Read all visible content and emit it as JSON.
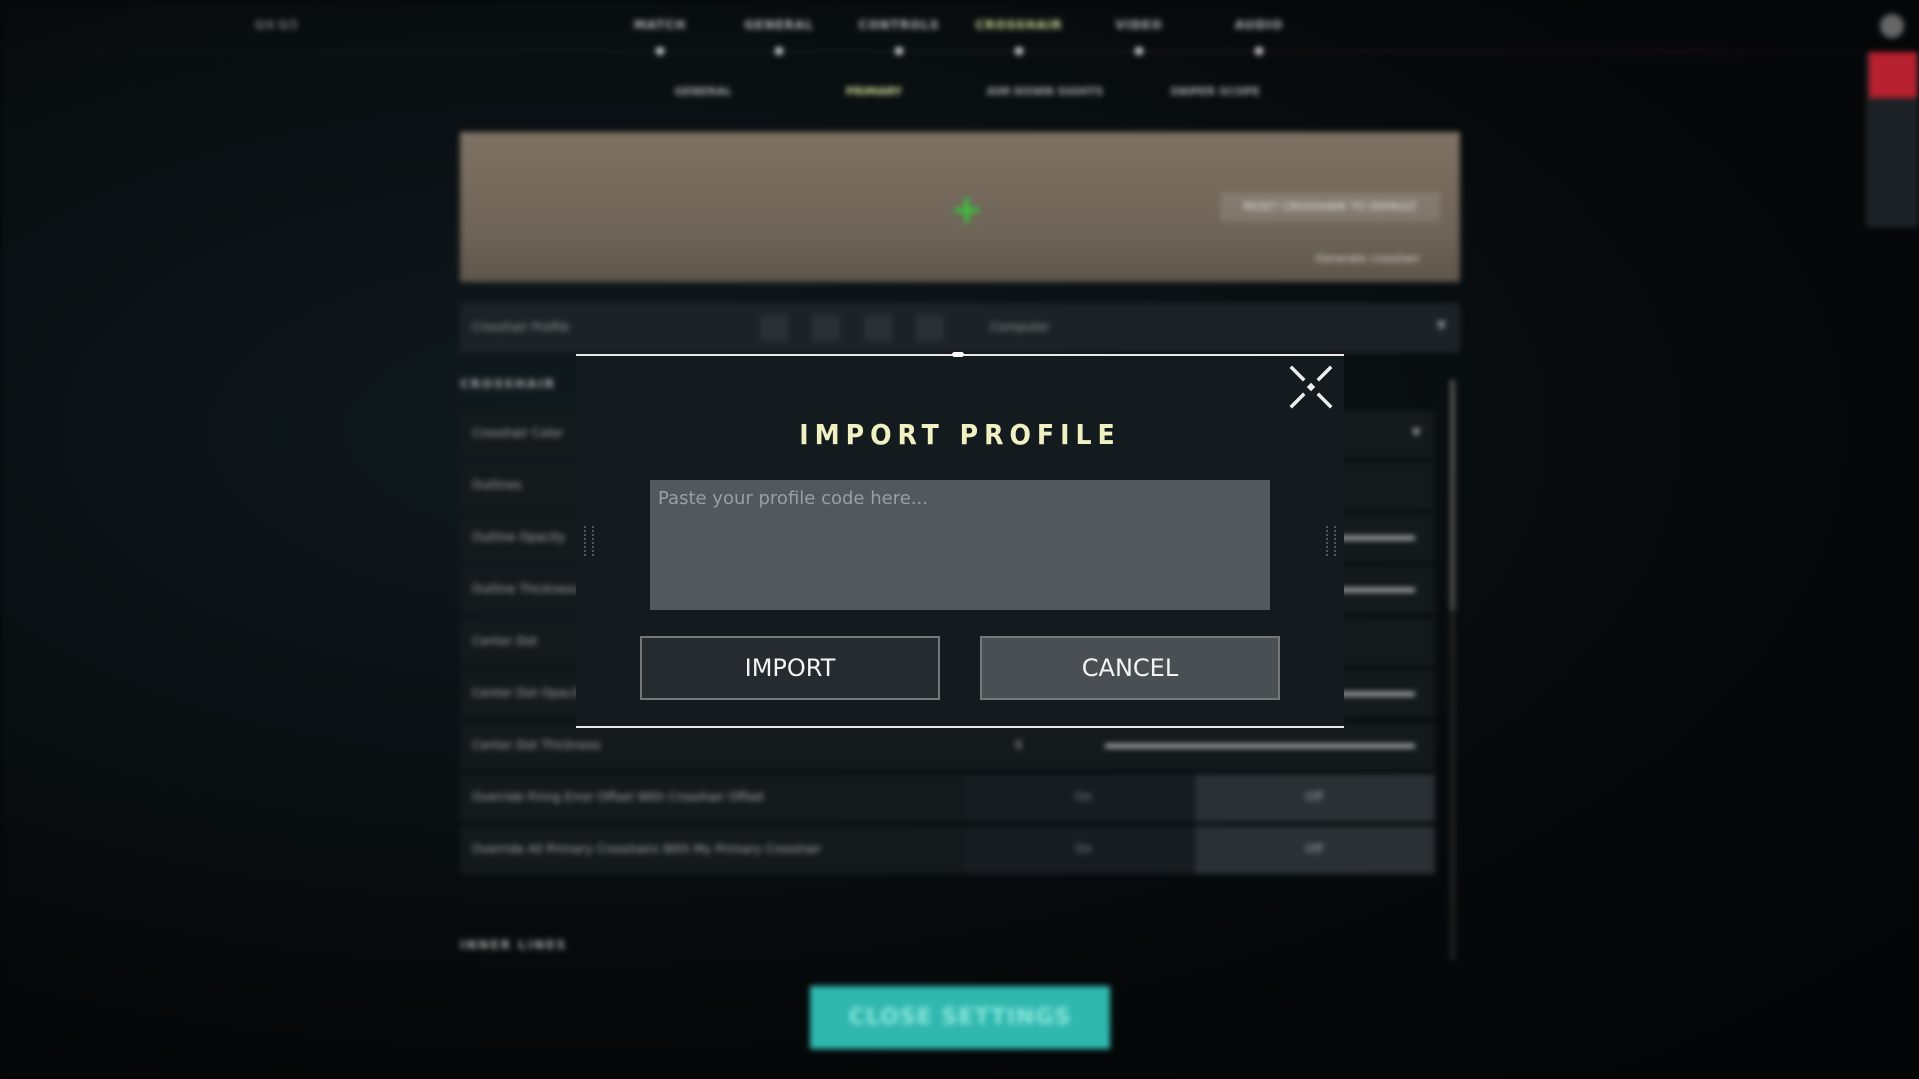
{
  "background": {
    "top_status": "0/4  0/3",
    "nav": [
      {
        "label": "MATCH",
        "active": false
      },
      {
        "label": "GENERAL",
        "active": false
      },
      {
        "label": "CONTROLS",
        "active": false
      },
      {
        "label": "CROSSHAIR",
        "active": true
      },
      {
        "label": "VIDEO",
        "active": false
      },
      {
        "label": "AUDIO",
        "active": false
      }
    ],
    "subnav": [
      {
        "label": "GENERAL",
        "active": false
      },
      {
        "label": "PRIMARY",
        "active": true
      },
      {
        "label": "AIM DOWN SIGHTS",
        "active": false
      },
      {
        "label": "SNIPER SCOPE",
        "active": false
      }
    ],
    "preview_button": "RESET CROSSHAIR TO DEFAULT",
    "preview_link": "Generate crosshair",
    "profile_label": "Crosshair Profile",
    "profile_select": "Computer",
    "section_crosshair": "CROSSHAIR",
    "rows": [
      {
        "label": "Crosshair Color",
        "type": "select"
      },
      {
        "label": "Outlines",
        "type": "toggle"
      },
      {
        "label": "Outline Opacity",
        "type": "slider"
      },
      {
        "label": "Outline Thickness",
        "type": "slider"
      },
      {
        "label": "Center Dot",
        "type": "toggle"
      },
      {
        "label": "Center Dot Opacity",
        "type": "slider"
      },
      {
        "label": "Center Dot Thickness",
        "type": "slider",
        "value": "6"
      },
      {
        "label": "Override Firing Error Offset With Crosshair Offset",
        "type": "onoff",
        "on": "On",
        "off": "Off"
      },
      {
        "label": "Override All Primary Crosshairs With My Primary Crosshair",
        "type": "onoff",
        "on": "On",
        "off": "Off"
      }
    ],
    "section_inner": "INNER LINES",
    "close_settings": "CLOSE SETTINGS",
    "accent_color": "#2fb8ae"
  },
  "modal": {
    "title": "IMPORT PROFILE",
    "input_value": "",
    "input_placeholder": "Paste your profile code here...",
    "import_label": "IMPORT",
    "cancel_label": "CANCEL",
    "close_icon": "close-x-icon",
    "title_color": "#f1f0c2"
  }
}
